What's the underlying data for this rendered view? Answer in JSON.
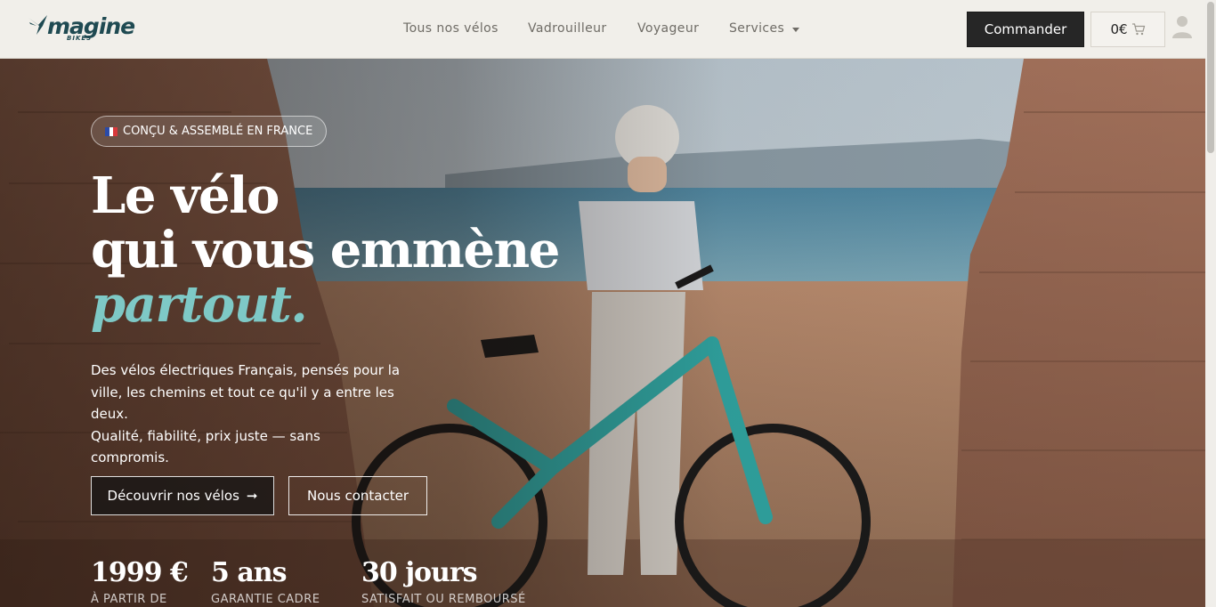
{
  "header": {
    "logo_text": "magine",
    "logo_sub": "BIKES",
    "nav": [
      {
        "label": "Tous nos vélos"
      },
      {
        "label": "Vadrouilleur"
      },
      {
        "label": "Voyageur"
      },
      {
        "label": "Services"
      }
    ],
    "order_label": "Commander",
    "cart_amount": "0€",
    "icons": {
      "cart": "cart-icon",
      "user": "user-icon",
      "services_dropdown": "chevron-down-icon"
    }
  },
  "hero": {
    "badge": "CONÇU & ASSEMBLÉ EN FRANCE",
    "title_line1": "Le vélo",
    "title_line2": "qui vous emmène",
    "title_line3": "partout.",
    "description_lines": [
      "Des vélos électriques Français, pensés pour la",
      "ville, les chemins et tout ce qu'il y a entre les",
      "deux.",
      "Qualité, fiabilité, prix juste — sans compromis."
    ],
    "primary_button": "Découvrir nos vélos",
    "primary_button_arrow": "➞",
    "secondary_button": "Nous contacter",
    "stats": [
      {
        "value": "1999 €",
        "label": "À PARTIR DE"
      },
      {
        "value": "5 ans",
        "label": "GARANTIE CADRE"
      },
      {
        "value": "30 jours",
        "label": "SATISFAIT OU REMBOURSÉ"
      }
    ]
  },
  "colors": {
    "accent": "#7ec9c6",
    "dark_button": "#262626",
    "header_bg": "#f1efea",
    "brand": "#1f4a52",
    "bike_frame": "#2fa3a0"
  }
}
